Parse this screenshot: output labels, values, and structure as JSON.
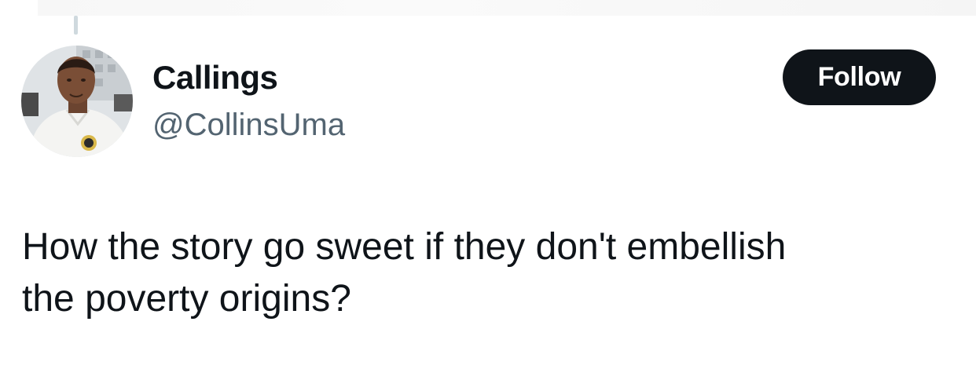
{
  "tweet": {
    "author": {
      "display_name": "Callings",
      "handle": "@CollinsUma",
      "avatar_icon": "profile-photo"
    },
    "follow_button_label": "Follow",
    "text_line1": "How the story go sweet if they don't embellish",
    "text_line2": "the poverty origins?"
  },
  "colors": {
    "text_primary": "#0f1419",
    "text_secondary": "#536471",
    "button_bg": "#0f1419",
    "button_text": "#ffffff",
    "thread_line": "#cfd9de"
  }
}
